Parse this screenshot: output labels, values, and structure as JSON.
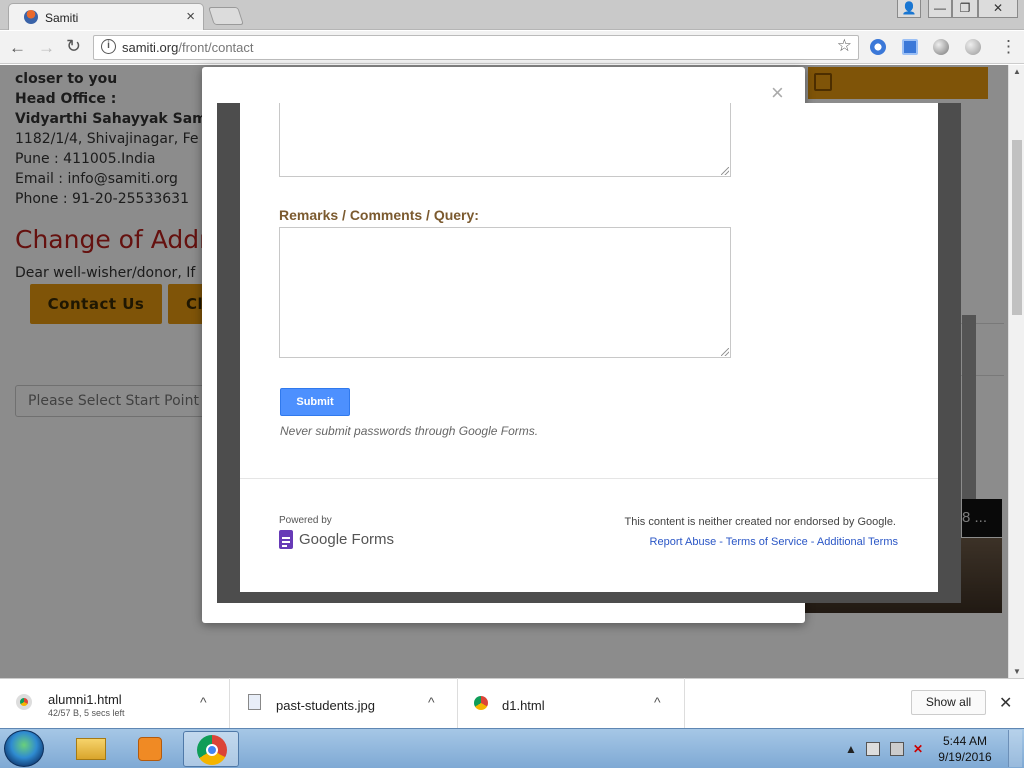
{
  "browser": {
    "tab_title": "Samiti",
    "tab_close": "×",
    "url_domain": "samiti.org",
    "url_path": "/front/contact",
    "win_user": "👤",
    "win_min": "—",
    "win_max": "❐",
    "win_close": "✕",
    "back": "←",
    "forward": "→",
    "reload": "↻",
    "info": "i",
    "star": "☆",
    "menu": "⋮"
  },
  "page": {
    "bg_lines": [
      "closer to you",
      "Head Office :",
      "Vidyarthi Sahayyak Sam",
      "1182/1/4, Shivajinagar, Fe",
      "Pune : 411005.India",
      "Email : info@samiti.org",
      "Phone : 91-20-25533631"
    ],
    "change_title": "Change of Addr",
    "dear_text": "Dear well-wisher/donor, If",
    "contact_btn": "Contact Us",
    "second_btn": "Cl",
    "select_start": "Please Select Start Point",
    "photo_caption": "8 ..."
  },
  "modal": {
    "close": "×",
    "remarks_label": "Remarks / Comments / Query:",
    "submit_label": "Submit",
    "never_pw": "Never submit passwords through Google Forms.",
    "powered_by": "Powered by",
    "gforms_name": "Google Forms",
    "not_endorsed": "This content is neither created nor endorsed by Google.",
    "link_report": "Report Abuse",
    "link_sep": " - ",
    "link_terms": "Terms of Service",
    "link_additional": "Additional Terms"
  },
  "downloads": {
    "items": [
      {
        "name": "alumni1.html",
        "status": "42/57 B, 5 secs left",
        "icon": "chrome-icon"
      },
      {
        "name": "past-students.jpg",
        "status": "",
        "icon": "image-file-icon"
      },
      {
        "name": "d1.html",
        "status": "",
        "icon": "chrome-icon"
      }
    ],
    "chevron": "^",
    "show_all": "Show all",
    "close": "✕"
  },
  "taskbar": {
    "time": "5:44 AM",
    "date": "9/19/2016",
    "tray_arrow": "▲"
  },
  "colors": {
    "accent_orange": "#e89a0f",
    "submit_blue": "#4d90fe",
    "label_brown": "#7b5a2f",
    "link_blue": "#2a56c6",
    "title_red": "#b8201c"
  }
}
